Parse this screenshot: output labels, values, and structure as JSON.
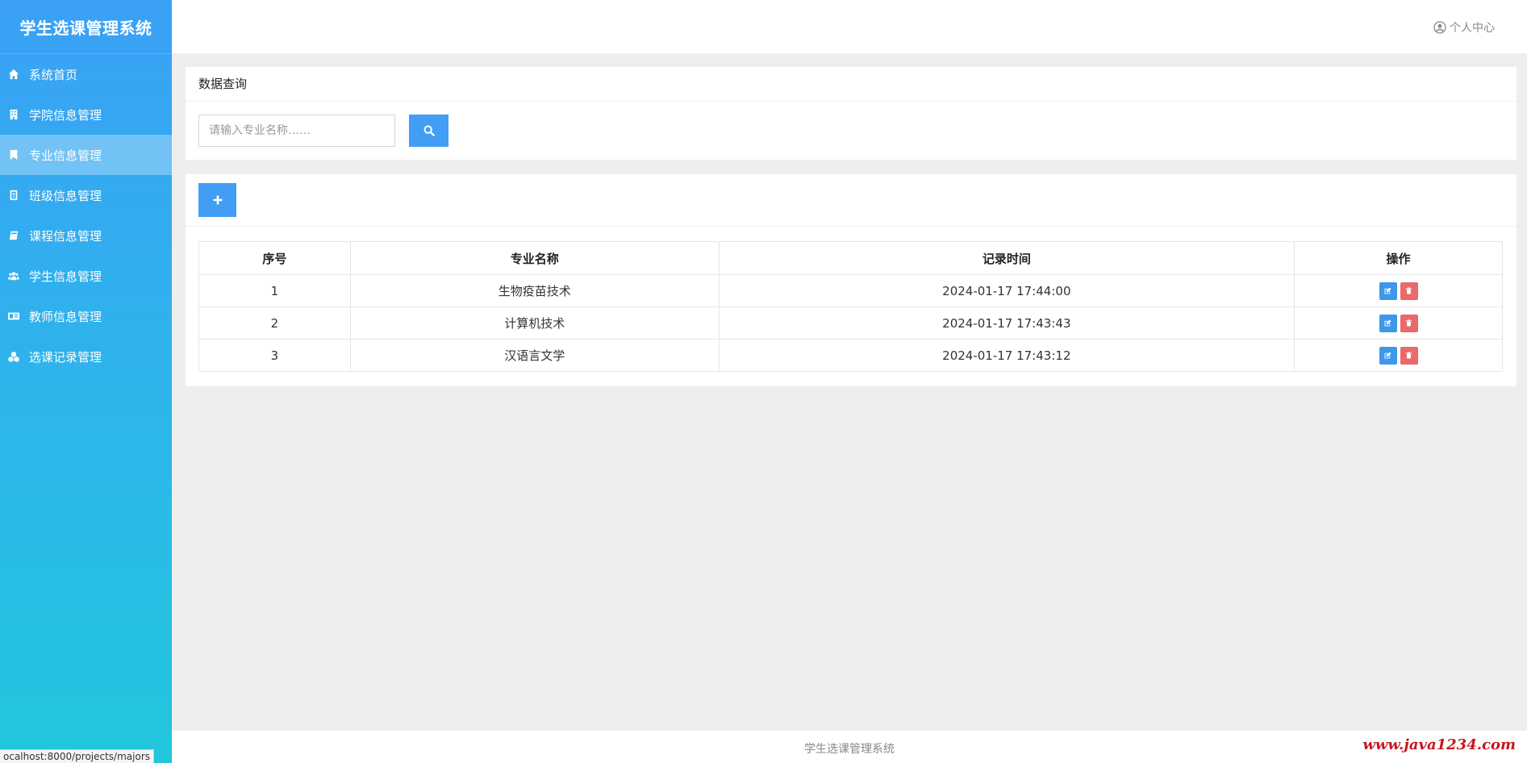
{
  "app": {
    "title": "学生选课管理系统"
  },
  "header": {
    "user_center": "个人中心"
  },
  "sidebar": {
    "items": [
      {
        "label": "系统首页",
        "icon": "home-icon"
      },
      {
        "label": "学院信息管理",
        "icon": "building-icon"
      },
      {
        "label": "专业信息管理",
        "icon": "bookmark-icon",
        "active": true
      },
      {
        "label": "班级信息管理",
        "icon": "badge-icon"
      },
      {
        "label": "课程信息管理",
        "icon": "book-icon"
      },
      {
        "label": "学生信息管理",
        "icon": "users-icon"
      },
      {
        "label": "教师信息管理",
        "icon": "id-card-icon"
      },
      {
        "label": "选课记录管理",
        "icon": "cubes-icon"
      }
    ]
  },
  "search": {
    "panel_title": "数据查询",
    "placeholder": "请输入专业名称……",
    "value": ""
  },
  "table": {
    "headers": [
      "序号",
      "专业名称",
      "记录时间",
      "操作"
    ],
    "rows": [
      {
        "idx": "1",
        "name": "生物疫苗技术",
        "time": "2024-01-17 17:44:00"
      },
      {
        "idx": "2",
        "name": "计算机技术",
        "time": "2024-01-17 17:43:43"
      },
      {
        "idx": "3",
        "name": "汉语言文学",
        "time": "2024-01-17 17:43:12"
      }
    ]
  },
  "footer": {
    "text": "学生选课管理系统"
  },
  "watermark": "www.java1234.com",
  "status_bar": {
    "url": "ocalhost:8000/projects/majors"
  },
  "colors": {
    "primary": "#419ef4",
    "danger": "#e86a6a",
    "sidebar_top": "#3aa0f6",
    "sidebar_bottom": "#22c6dd"
  }
}
